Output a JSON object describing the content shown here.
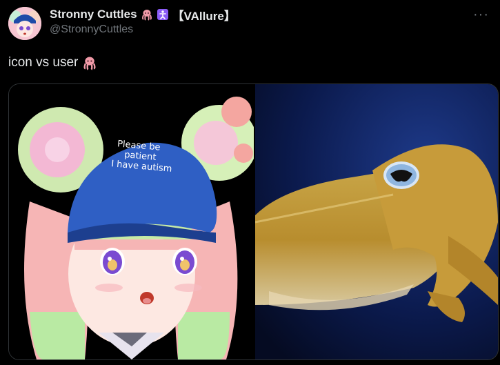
{
  "tweet": {
    "display_name": "Stronny Cuttles",
    "badge_text": "【VAllure】",
    "handle": "@StronnyCuttles",
    "more_label": "···",
    "text": "icon vs user",
    "emojis": [
      "octopus-emoji",
      "accessibility-badge-icon"
    ]
  },
  "media": {
    "left_image": {
      "subject": "anime-avatar-girl-with-cap",
      "cap_text": [
        "Please be",
        "patient",
        "I have autism"
      ]
    },
    "right_image": {
      "subject": "cuttlefish-photo"
    }
  },
  "colors": {
    "background": "#000000",
    "text": "#e7e9ea",
    "muted": "#71767b",
    "border": "#2f3336",
    "octopus": "#f19aa8",
    "badge": "#8b5cf6"
  }
}
